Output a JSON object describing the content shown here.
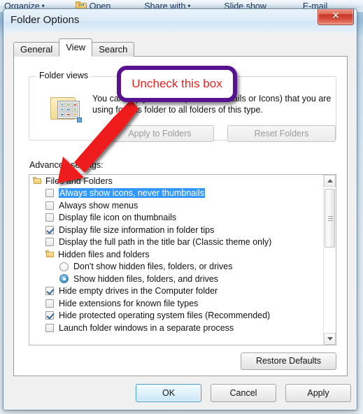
{
  "background": {
    "toolbar": [
      {
        "label": "Organize",
        "caret": "▾",
        "icon": null
      },
      {
        "label": "Open",
        "caret": "",
        "icon": "folder-icon"
      },
      {
        "label": "Share with",
        "caret": "▾",
        "icon": null
      },
      {
        "label": "Slide show",
        "caret": "",
        "icon": null
      },
      {
        "label": "E-mail",
        "caret": "",
        "icon": null
      }
    ]
  },
  "dialog": {
    "title": "Folder Options",
    "close_label": "✕",
    "tabs": [
      {
        "label": "General",
        "active": false
      },
      {
        "label": "View",
        "active": true
      },
      {
        "label": "Search",
        "active": false
      }
    ],
    "folder_views": {
      "legend": "Folder views",
      "description": "You can apply the view (such as Details or Icons) that you are using for this folder to all folders of this type.",
      "apply_button": "Apply to Folders",
      "reset_button": "Reset Folders",
      "apply_disabled": true,
      "reset_disabled": true
    },
    "advanced": {
      "label": "Advanced settings:",
      "items": [
        {
          "type": "group",
          "label": "Files and Folders",
          "checked": false,
          "selected": false
        },
        {
          "type": "checkbox",
          "label": "Always show icons, never thumbnails",
          "checked": false,
          "selected": true
        },
        {
          "type": "checkbox",
          "label": "Always show menus",
          "checked": false,
          "selected": false
        },
        {
          "type": "checkbox",
          "label": "Display file icon on thumbnails",
          "checked": false,
          "selected": false
        },
        {
          "type": "checkbox",
          "label": "Display file size information in folder tips",
          "checked": true,
          "selected": false
        },
        {
          "type": "checkbox",
          "label": "Display the full path in the title bar (Classic theme only)",
          "checked": false,
          "selected": false
        },
        {
          "type": "group",
          "label": "Hidden files and folders",
          "checked": false,
          "selected": false
        },
        {
          "type": "radio",
          "label": "Don't show hidden files, folders, or drives",
          "checked": false,
          "selected": false
        },
        {
          "type": "radio",
          "label": "Show hidden files, folders, and drives",
          "checked": true,
          "selected": false
        },
        {
          "type": "checkbox",
          "label": "Hide empty drives in the Computer folder",
          "checked": true,
          "selected": false
        },
        {
          "type": "checkbox",
          "label": "Hide extensions for known file types",
          "checked": false,
          "selected": false
        },
        {
          "type": "checkbox",
          "label": "Hide protected operating system files (Recommended)",
          "checked": true,
          "selected": false
        },
        {
          "type": "checkbox",
          "label": "Launch folder windows in a separate process",
          "checked": false,
          "selected": false
        }
      ]
    },
    "restore_defaults": "Restore Defaults",
    "buttons": {
      "ok": "OK",
      "cancel": "Cancel",
      "apply": "Apply"
    }
  },
  "annotation": {
    "callout_text": "Uncheck this box",
    "callout_border_color": "#58118f",
    "callout_text_color": "#ef2020",
    "arrow_color": "#ee1c1c"
  }
}
